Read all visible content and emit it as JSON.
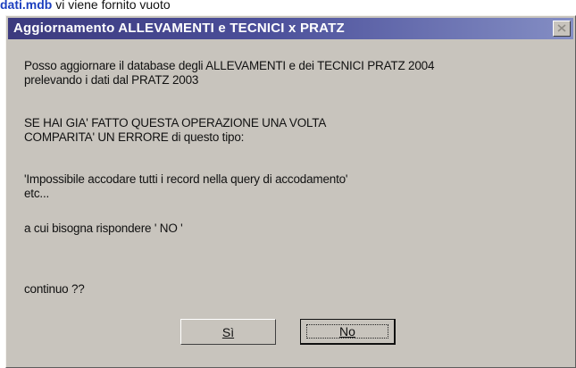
{
  "page_header": {
    "file_name": "dati.mdb",
    "rest": " vi viene fornito vuoto"
  },
  "dialog": {
    "title": "Aggiornamento ALLEVAMENTI e TECNICI x PRATZ",
    "message": {
      "line1": "Posso aggiornare il database degli ALLEVAMENTI e dei TECNICI PRATZ 2004",
      "line2": "prelevando i dati dal PRATZ 2003",
      "line3": "SE HAI GIA' FATTO QUESTA OPERAZIONE UNA VOLTA",
      "line4": "COMPARITA' UN ERRORE di questo tipo:",
      "line5": "'Impossibile accodare tutti i record nella query di accodamento'",
      "line6": "etc...",
      "line7": "a cui bisogna rispondere ' NO '",
      "line8": "continuo ??"
    },
    "buttons": {
      "yes": "Sì",
      "no": "No"
    }
  },
  "icons": {
    "close": "close-icon"
  },
  "colors": {
    "dialog_bg": "#c8c4bd",
    "titlebar_start": "#3c3a7e",
    "titlebar_end": "#848ec4",
    "link_blue": "#1c3fbf"
  }
}
